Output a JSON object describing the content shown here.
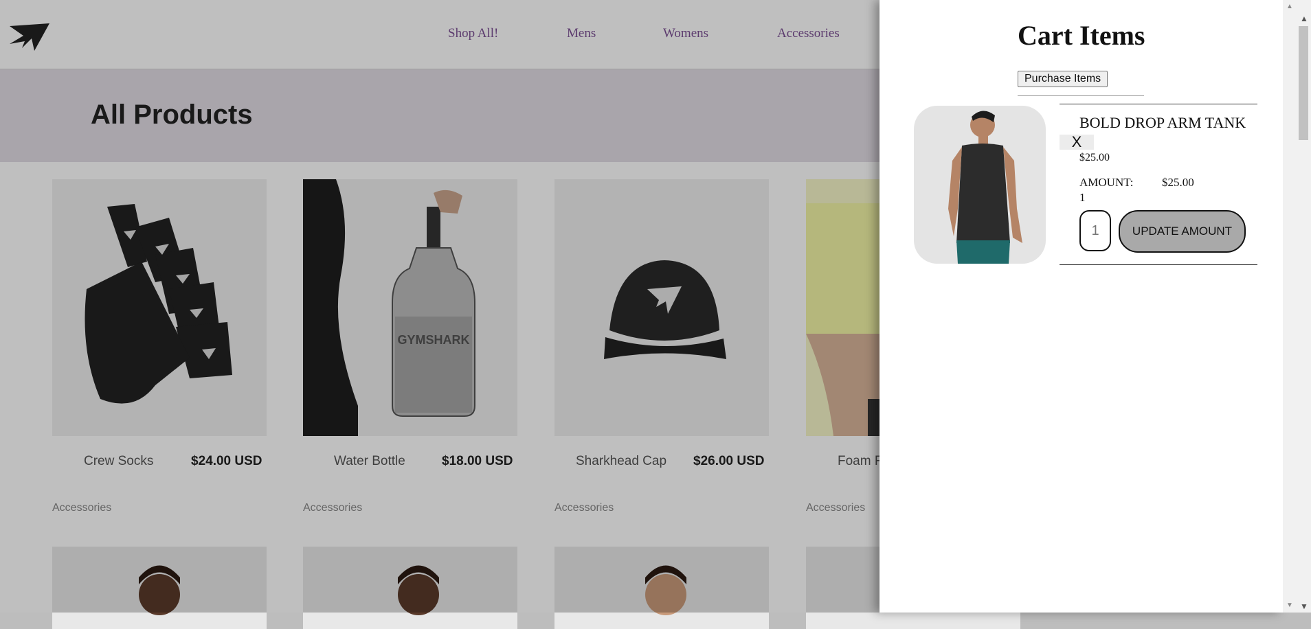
{
  "nav": {
    "items": [
      "Shop All!",
      "Mens",
      "Womens",
      "Accessories"
    ]
  },
  "hero": {
    "title": "All Products"
  },
  "products": [
    {
      "name": "Crew Socks",
      "price": "$24.00 USD",
      "category": "Accessories"
    },
    {
      "name": "Water Bottle",
      "price": "$18.00 USD",
      "category": "Accessories"
    },
    {
      "name": "Sharkhead Cap",
      "price": "$26.00 USD",
      "category": "Accessories"
    },
    {
      "name": "Foam R",
      "price": "",
      "category": "Accessories"
    }
  ],
  "cart": {
    "title": "Cart Items",
    "purchase_label": "Purchase Items",
    "item": {
      "name": "BOLD DROP ARM TANK",
      "remove_label": "X",
      "price": "$25.00",
      "amount_label": "AMOUNT:",
      "amount_value": "$25.00",
      "quantity_text": "1",
      "quantity_placeholder": "1",
      "update_label": "UPDATE AMOUNT"
    }
  },
  "colors": {
    "nav_link": "#7b4f93",
    "update_button": "#a9a9a9"
  },
  "icons": {
    "logo": "gymshark-logo",
    "scroll_up": "triangle-up",
    "scroll_down": "triangle-down"
  }
}
